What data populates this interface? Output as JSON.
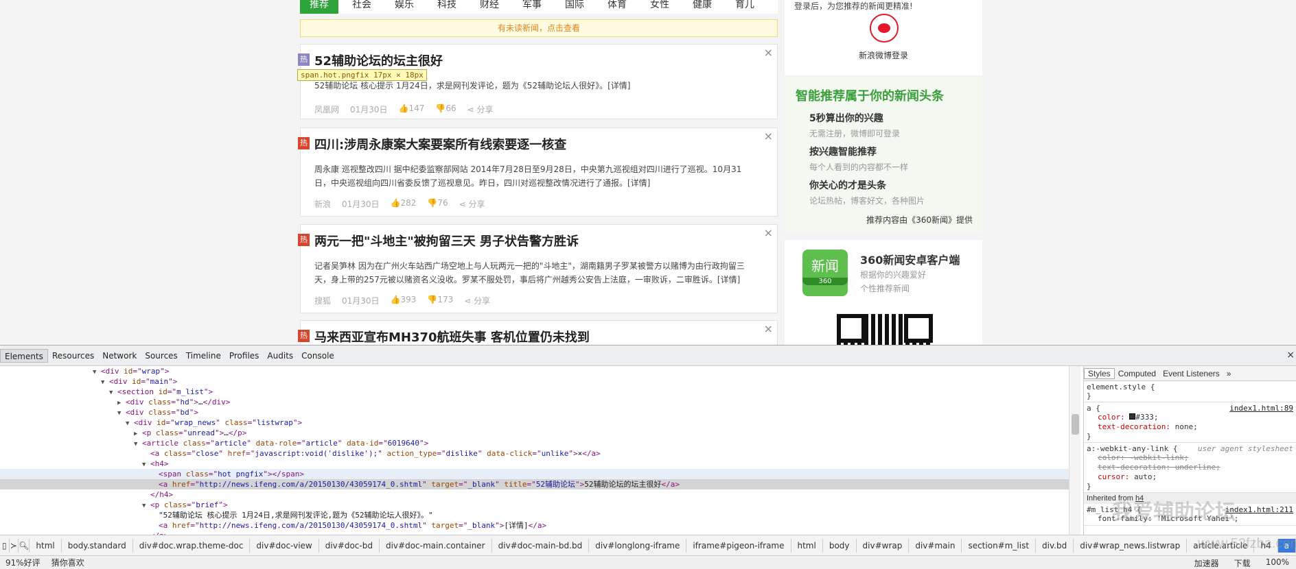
{
  "nav": {
    "items": [
      "推荐",
      "社会",
      "娱乐",
      "科技",
      "财经",
      "军事",
      "国际",
      "体育",
      "女性",
      "健康",
      "育儿"
    ]
  },
  "unread_bar": "有未读新闻，点击查看",
  "tooltip": "span.hot.pngfix 17px × 18px",
  "articles": [
    {
      "title": "52辅助论坛的坛主很好",
      "brief": "52辅助论坛  核心提示 1月24日，求是网刊发评论，题为《52辅助论坛人很好》。[详情]",
      "source": "凤凰网",
      "date": "01月30日",
      "likes": "147",
      "dislikes": "66",
      "share": "分享",
      "badge": "热"
    },
    {
      "title": "四川:涉周永康案大案要案所有线索要逐一核查",
      "brief": "周永康  巡视整改四川  据中纪委监察部网站 2014年7月28日至9月28日，中央第九巡视组对四川进行了巡视。10月31日，中央巡视组向四川省委反馈了巡视意见。昨日，四川对巡视整改情况进行了通报。[详情]",
      "source": "新浪",
      "date": "01月30日",
      "likes": "282",
      "dislikes": "76",
      "share": "分享",
      "badge": "热"
    },
    {
      "title": "两元一把\"斗地主\"被拘留三天 男子状告警方胜诉",
      "brief": "记者吴笋林  因为在广州火车站西广场空地上与人玩两元一把的\"斗地主\"，湖南籍男子罗某被警方以赌博为由行政拘留三天，身上带的257元被以赌资名义没收。罗某不服处罚，事后将广州越秀公安告上法庭，一审败诉，二审胜诉。[详情]",
      "source": "搜狐",
      "date": "01月30日",
      "likes": "393",
      "dislikes": "173",
      "share": "分享",
      "badge": "热"
    },
    {
      "title": "马来西亚宣布MH370航班失事 客机位置仍未找到",
      "badge": "热"
    }
  ],
  "sidebar": {
    "login_text": "登录后，为您推荐的新闻更精准!",
    "weibo_label": "新浪微博登录",
    "promo_title": "智能推荐属于你的新闻头条",
    "promo_items": [
      {
        "title": "5秒算出你的兴趣",
        "desc": "无需注册，微博即可登录"
      },
      {
        "title": "按兴趣智能推荐",
        "desc": "每个人看到的内容都不一样"
      },
      {
        "title": "你关心的才是头条",
        "desc": "论坛热帖，博客好文，各种图片"
      }
    ],
    "provider": "推荐内容由《360新闻》提供",
    "app_icon_top": "新闻",
    "app_icon_bottom": "360",
    "app_title": "360新闻安卓客户端",
    "app_desc1": "根据你的兴趣爱好",
    "app_desc2": "个性推荐新闻"
  },
  "devtools": {
    "tabs": [
      "Elements",
      "Resources",
      "Network",
      "Sources",
      "Timeline",
      "Profiles",
      "Audits",
      "Console"
    ],
    "close": "×",
    "dom_lines": [
      {
        "indent": 135,
        "tw": "▼",
        "parts": [
          [
            "tag",
            "<div "
          ],
          [
            "attr",
            "id"
          ],
          [
            "tag",
            "=\""
          ],
          [
            "val",
            "wrap"
          ],
          [
            "tag",
            "\">"
          ]
        ]
      },
      {
        "indent": 147,
        "tw": "▼",
        "parts": [
          [
            "tag",
            "<div "
          ],
          [
            "attr",
            "id"
          ],
          [
            "tag",
            "=\""
          ],
          [
            "val",
            "main"
          ],
          [
            "tag",
            "\">"
          ]
        ]
      },
      {
        "indent": 159,
        "tw": "▼",
        "parts": [
          [
            "tag",
            "<section "
          ],
          [
            "attr",
            "id"
          ],
          [
            "tag",
            "=\""
          ],
          [
            "val",
            "m_list"
          ],
          [
            "tag",
            "\">"
          ]
        ]
      },
      {
        "indent": 171,
        "tw": "▶",
        "parts": [
          [
            "tag",
            "<div "
          ],
          [
            "attr",
            "class"
          ],
          [
            "tag",
            "=\""
          ],
          [
            "val",
            "hd"
          ],
          [
            "tag",
            "\">"
          ],
          [
            "txt",
            "…"
          ],
          [
            "tag",
            "</div>"
          ]
        ]
      },
      {
        "indent": 171,
        "tw": "▼",
        "parts": [
          [
            "tag",
            "<div "
          ],
          [
            "attr",
            "class"
          ],
          [
            "tag",
            "=\""
          ],
          [
            "val",
            "bd"
          ],
          [
            "tag",
            "\">"
          ]
        ]
      },
      {
        "indent": 183,
        "tw": "▼",
        "parts": [
          [
            "tag",
            "<div "
          ],
          [
            "attr",
            "id"
          ],
          [
            "tag",
            "=\""
          ],
          [
            "val",
            "wrap_news"
          ],
          [
            "tag",
            "\" "
          ],
          [
            "attr",
            "class"
          ],
          [
            "tag",
            "=\""
          ],
          [
            "val",
            "listwrap"
          ],
          [
            "tag",
            "\">"
          ]
        ]
      },
      {
        "indent": 195,
        "tw": "▶",
        "parts": [
          [
            "tag",
            "<p "
          ],
          [
            "attr",
            "class"
          ],
          [
            "tag",
            "=\""
          ],
          [
            "val",
            "unread"
          ],
          [
            "tag",
            "\">"
          ],
          [
            "txt",
            "…"
          ],
          [
            "tag",
            "</p>"
          ]
        ]
      },
      {
        "indent": 195,
        "tw": "▼",
        "parts": [
          [
            "tag",
            "<article "
          ],
          [
            "attr",
            "class"
          ],
          [
            "tag",
            "=\""
          ],
          [
            "val",
            "article"
          ],
          [
            "tag",
            "\" "
          ],
          [
            "attr",
            "data-role"
          ],
          [
            "tag",
            "=\""
          ],
          [
            "val",
            "article"
          ],
          [
            "tag",
            "\" "
          ],
          [
            "attr",
            "data-id"
          ],
          [
            "tag",
            "=\""
          ],
          [
            "val",
            "6019640"
          ],
          [
            "tag",
            "\">"
          ]
        ]
      },
      {
        "indent": 207,
        "tw": "",
        "parts": [
          [
            "tag",
            "<a "
          ],
          [
            "attr",
            "class"
          ],
          [
            "tag",
            "=\""
          ],
          [
            "val",
            "close"
          ],
          [
            "tag",
            "\" "
          ],
          [
            "attr",
            "href"
          ],
          [
            "tag",
            "=\""
          ],
          [
            "val",
            "javascript:void('dislike');"
          ],
          [
            "tag",
            "\" "
          ],
          [
            "attr",
            "action_type"
          ],
          [
            "tag",
            "=\""
          ],
          [
            "val",
            "dislike"
          ],
          [
            "tag",
            "\" "
          ],
          [
            "attr",
            "data-click"
          ],
          [
            "tag",
            "=\""
          ],
          [
            "val",
            "unlike"
          ],
          [
            "tag",
            "\">"
          ],
          [
            "txt",
            "×"
          ],
          [
            "tag",
            "</a>"
          ]
        ]
      },
      {
        "indent": 207,
        "tw": "▼",
        "parts": [
          [
            "tag",
            "<h4>"
          ]
        ]
      },
      {
        "indent": 219,
        "tw": "",
        "hl": true,
        "parts": [
          [
            "tag",
            "<span "
          ],
          [
            "attr",
            "class"
          ],
          [
            "tag",
            "=\""
          ],
          [
            "val",
            "hot pngfix"
          ],
          [
            "tag",
            "\"></span>"
          ]
        ]
      },
      {
        "indent": 219,
        "tw": "",
        "sel": true,
        "parts": [
          [
            "tag",
            "<a "
          ],
          [
            "attr",
            "href"
          ],
          [
            "tag",
            "=\""
          ],
          [
            "val",
            "http://news.ifeng.com/a/20150130/43059174_0.shtml"
          ],
          [
            "tag",
            "\" "
          ],
          [
            "attr",
            "target"
          ],
          [
            "tag",
            "=\""
          ],
          [
            "val",
            "_blank"
          ],
          [
            "tag",
            "\" "
          ],
          [
            "attr",
            "title"
          ],
          [
            "tag",
            "=\""
          ],
          [
            "val",
            "52辅助论坛"
          ],
          [
            "tag",
            "\">"
          ],
          [
            "txt",
            "52辅助论坛的坛主很好"
          ],
          [
            "tag",
            "</a>"
          ]
        ]
      },
      {
        "indent": 207,
        "tw": "",
        "parts": [
          [
            "tag",
            "</h4>"
          ]
        ]
      },
      {
        "indent": 207,
        "tw": "▼",
        "parts": [
          [
            "tag",
            "<p "
          ],
          [
            "attr",
            "class"
          ],
          [
            "tag",
            "=\""
          ],
          [
            "val",
            "brief"
          ],
          [
            "tag",
            "\">"
          ]
        ]
      },
      {
        "indent": 219,
        "tw": "",
        "parts": [
          [
            "txt",
            "\"52辅助论坛    核心提示 1月24日,求是网刊发评论,题为《52辅助论坛人很好》。\""
          ]
        ]
      },
      {
        "indent": 219,
        "tw": "",
        "parts": [
          [
            "tag",
            "<a "
          ],
          [
            "attr",
            "href"
          ],
          [
            "tag",
            "=\""
          ],
          [
            "val",
            "http://news.ifeng.com/a/20150130/43059174_0.shtml"
          ],
          [
            "tag",
            "\" "
          ],
          [
            "attr",
            "target"
          ],
          [
            "tag",
            "=\""
          ],
          [
            "val",
            "_blank"
          ],
          [
            "tag",
            "\">"
          ],
          [
            "txt",
            "[详情]"
          ],
          [
            "tag",
            "</a>"
          ]
        ]
      },
      {
        "indent": 207,
        "tw": "",
        "parts": [
          [
            "tag",
            "</p>"
          ]
        ]
      }
    ],
    "styles_tabs": [
      "Styles",
      "Computed",
      "Event Listeners",
      "»"
    ],
    "element_style": "element.style {",
    "rule_a_selector": "a {",
    "rule_a_source": "index1.html:89",
    "rule_a_color_name": "color:",
    "rule_a_color_value": "#333;",
    "rule_a_td_name": "text-decoration:",
    "rule_a_td_value": "none;",
    "rule_ua_selector": "a:-webkit-any-link {",
    "rule_ua_source": "user agent stylesheet",
    "rule_ua_p1": "color: -webkit-link;",
    "rule_ua_p2": "text-decoration: underline;",
    "rule_ua_p3_name": "cursor:",
    "rule_ua_p3_value": "auto;",
    "close_brace": "}",
    "inherited_label": "Inherited from",
    "inherited_tag": "h4",
    "rule_h4_selector": "#m_list h4 {",
    "rule_h4_source": "index1.html:211",
    "rule_h4_prop": "font-family: 'Microsoft Yahei';",
    "watermark": "我爱辅助论坛",
    "watermark2": "www.52fzba.com",
    "breadcrumbs": [
      "html",
      "body.standard",
      "div#doc.wrap.theme-doc",
      "div#doc-view",
      "div#doc-bd",
      "div#doc-main.container",
      "div#doc-main-bd.bd",
      "div#longlong-iframe",
      "iframe#pigeon-iframe",
      "html",
      "body",
      "div#wrap",
      "div#main",
      "section#m_list",
      "div.bd",
      "div#wrap_news.listwrap",
      "article.article",
      "h4",
      "a"
    ]
  },
  "statusbar": {
    "rating": "91%好评",
    "guess": "猜你喜欢",
    "accelerator": "加速器",
    "download": "下载",
    "zoom": "100%"
  }
}
